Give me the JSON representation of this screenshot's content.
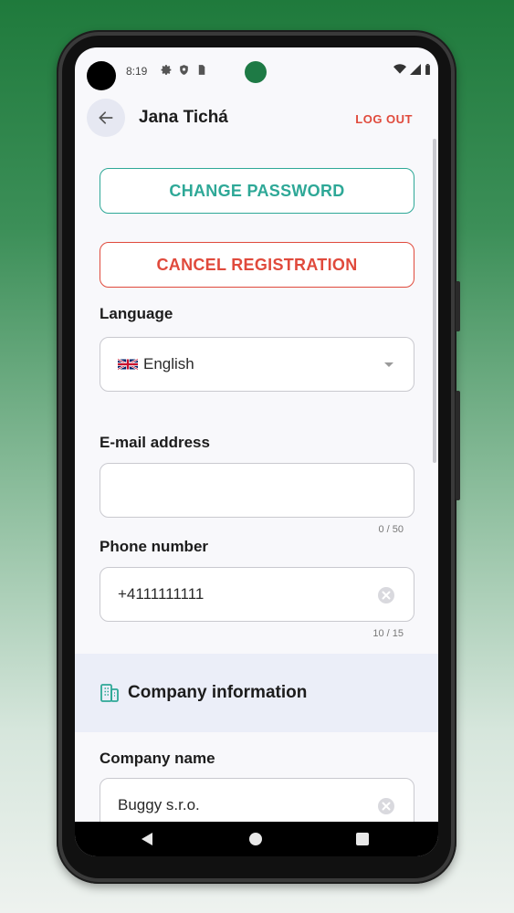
{
  "status_bar": {
    "time": "8:19",
    "icons": [
      "settings-icon",
      "shield-icon",
      "sim-icon"
    ],
    "right_icons": [
      "wifi-icon",
      "signal-icon",
      "battery-icon"
    ]
  },
  "app_bar": {
    "title": "Jana Tichá",
    "logout_label": "LOG OUT",
    "back_icon": "arrow-left-icon"
  },
  "actions": {
    "change_password_label": "CHANGE PASSWORD",
    "cancel_registration_label": "CANCEL REGISTRATION"
  },
  "language": {
    "label": "Language",
    "selected": "English",
    "flag": "uk-flag"
  },
  "email": {
    "label": "E-mail address",
    "value": "",
    "counter": "0 / 50"
  },
  "phone": {
    "label": "Phone number",
    "value": "+4111111111",
    "counter": "10 / 15"
  },
  "company_section": {
    "title": "Company information",
    "icon": "building-icon"
  },
  "company_name": {
    "label": "Company name",
    "value": "Buggy s.r.o."
  },
  "colors": {
    "accent_green": "#2ea897",
    "danger_red": "#e04a3c",
    "section_bg": "#ebeef8"
  },
  "nav_bar": {
    "icons": [
      "nav-back-icon",
      "nav-home-icon",
      "nav-recent-icon"
    ]
  }
}
